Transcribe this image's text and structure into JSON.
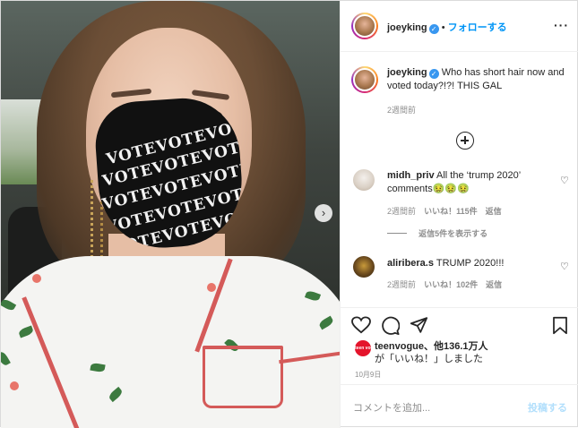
{
  "post": {
    "username": "joeyking",
    "follow_label": "フォローする",
    "separator": "•",
    "caption": "Who has short hair now and voted today?!?! THIS GAL",
    "caption_time": "2週間前",
    "date": "10月9日",
    "mask_text": "VOTEVOTEVOTE"
  },
  "comments": [
    {
      "username": "midh_priv",
      "text": "All the ‘trump 2020’ comments🤢🤢🤢",
      "time": "2週間前",
      "likes": "いいね！115件",
      "reply": "返信",
      "view_replies": "返信5件を表示する"
    },
    {
      "username": "aliribera.s",
      "text": "TRUMP 2020!!!",
      "time": "2週間前",
      "likes": "いいね！102件",
      "reply": "返信"
    }
  ],
  "likes": {
    "badge": "teen vogue",
    "line1": "teenvogue、他136.1万人",
    "line2": "が「いいね！」しました"
  },
  "comment_box": {
    "placeholder": "コメントを追加...",
    "post_label": "投稿する"
  },
  "icons": [
    "verified-icon",
    "more-icon",
    "add-icon",
    "heart-icon",
    "comment-icon",
    "share-icon",
    "bookmark-icon",
    "next-arrow-icon"
  ],
  "colors": {
    "link_blue": "#0095f6",
    "verified_blue": "#3897f0",
    "muted": "#8e8e8e",
    "post_button_disabled": "#b2dffc"
  }
}
